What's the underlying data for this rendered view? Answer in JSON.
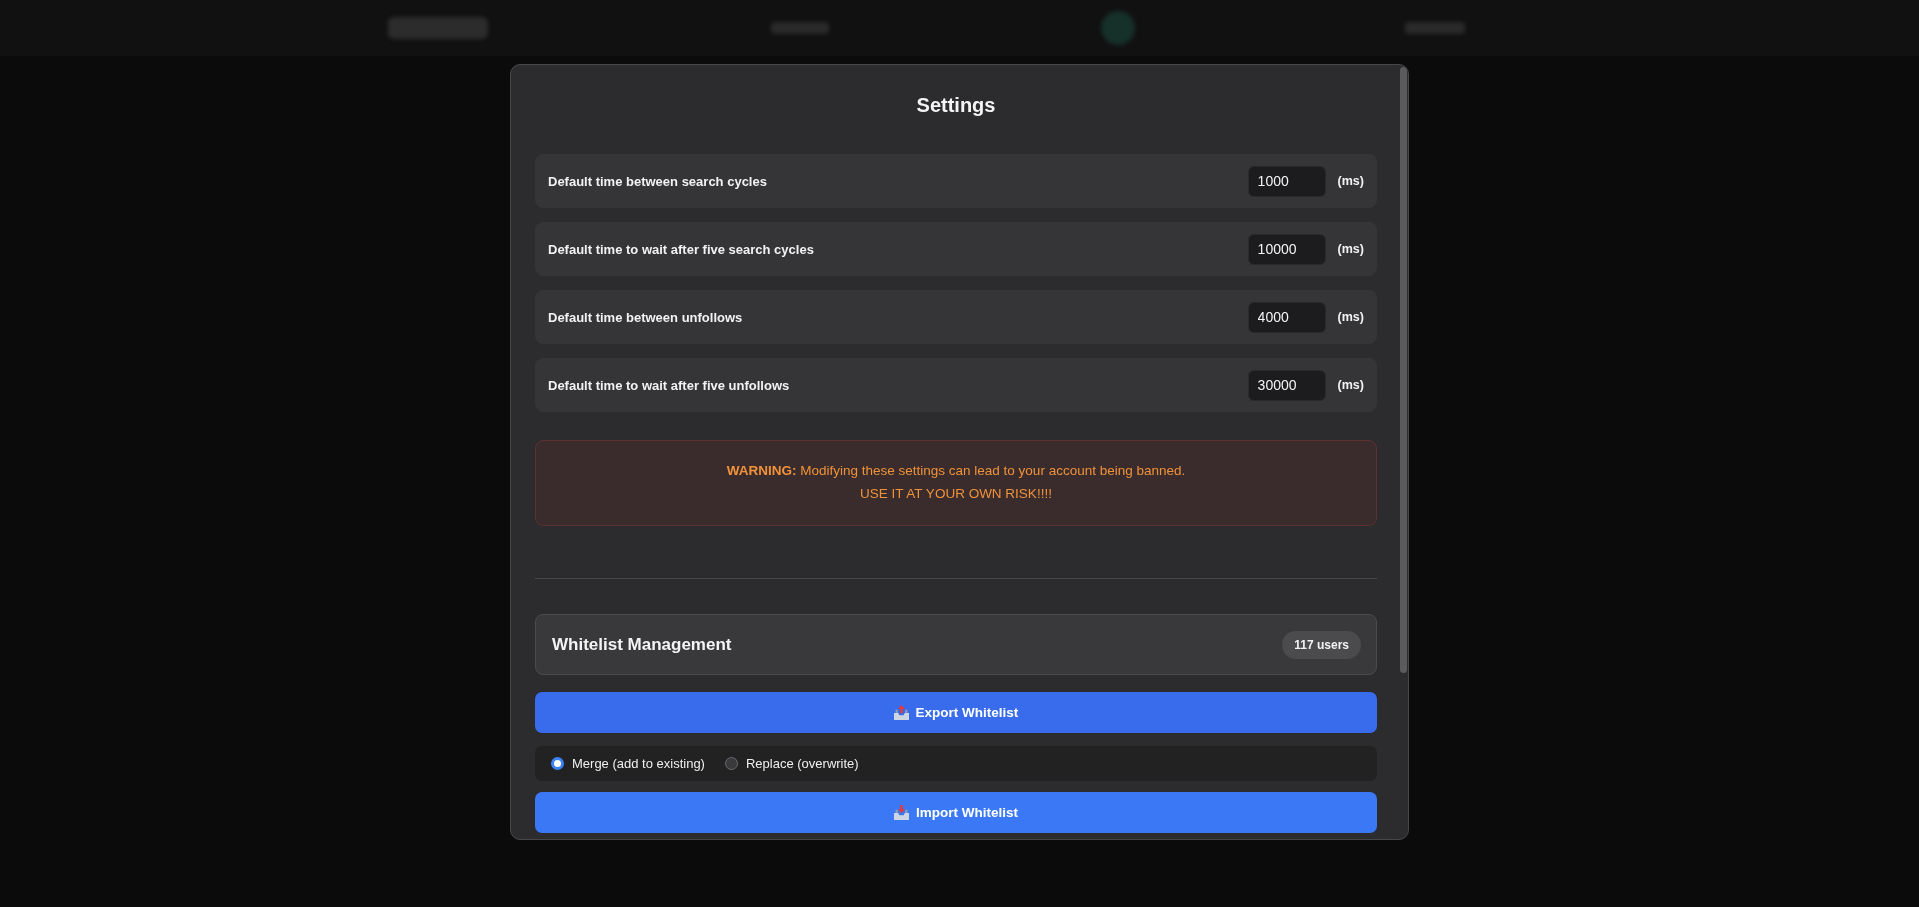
{
  "dialog": {
    "title": "Settings"
  },
  "settings": [
    {
      "label": "Default time between search cycles",
      "value": "1000",
      "unit": "(ms)"
    },
    {
      "label": "Default time to wait after five search cycles",
      "value": "10000",
      "unit": "(ms)"
    },
    {
      "label": "Default time between unfollows",
      "value": "4000",
      "unit": "(ms)"
    },
    {
      "label": "Default time to wait after five unfollows",
      "value": "30000",
      "unit": "(ms)"
    }
  ],
  "warning": {
    "text": "**WARNING:** Modifying these settings can lead to your account being banned.",
    "note": "USE IT AT YOUR OWN RISK!!!!"
  },
  "whitelist": {
    "title": "Whitelist Management",
    "count": "117 users"
  },
  "export_button": {
    "label": "Export Whitelist"
  },
  "import_modes": [
    {
      "label": "Merge (add to existing)",
      "selected": true
    },
    {
      "label": "Replace (overwrite)",
      "selected": false
    }
  ],
  "import_button": {
    "label": "Import Whitelist"
  }
}
